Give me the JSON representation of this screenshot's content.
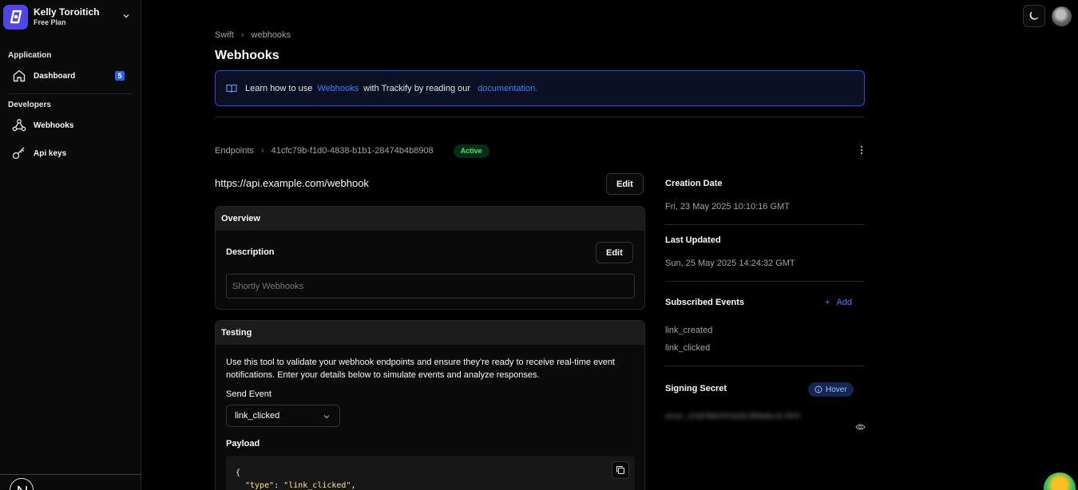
{
  "account": {
    "name": "Kelly Toroitich",
    "plan": "Free Plan"
  },
  "sidebar": {
    "application_label": "Application",
    "developers_label": "Developers",
    "items": [
      {
        "label": "Dashboard",
        "icon": "home-icon",
        "badge": "5"
      },
      {
        "label": "Webhooks",
        "icon": "webhook-icon"
      },
      {
        "label": "Api keys",
        "icon": "key-icon"
      }
    ]
  },
  "breadcrumb": {
    "root": "Swift",
    "current": "webhooks"
  },
  "page": {
    "title": "Webhooks"
  },
  "banner": {
    "prefix": "Learn how to use",
    "link1": "Webhooks",
    "middle": "with Trackify by reading our",
    "link2": "documentation."
  },
  "endpoint": {
    "crumb_root": "Endpoints",
    "id": "41cfc79b-f1d0-4838-b1b1-28474b4b8908",
    "status": "Active",
    "url": "https://api.example.com/webhook",
    "edit_label": "Edit"
  },
  "overview": {
    "title": "Overview",
    "description_label": "Description",
    "edit_label": "Edit",
    "description_placeholder": "Shortly Webhooks"
  },
  "testing": {
    "title": "Testing",
    "description": "Use this tool to validate your webhook endpoints and ensure they're ready to receive real-time event notifications. Enter your details below to simulate events and analyze responses.",
    "send_event_label": "Send Event",
    "selected_event": "link_clicked",
    "payload_label": "Payload",
    "payload_line1": "{",
    "payload_key": "\"type\"",
    "payload_value": "\"link_clicked\"",
    "payload_colon": ": ",
    "payload_comma": ","
  },
  "details": {
    "creation_label": "Creation Date",
    "creation_value": "Fri, 23 May 2025 10:10:16 GMT",
    "updated_label": "Last Updated",
    "updated_value": "Sun, 25 May 2025 14:24:32 GMT",
    "events_label": "Subscribed Events",
    "add_label": "Add",
    "events": [
      "link_created",
      "link_clicked"
    ],
    "secret_label": "Signing Secret",
    "hover_label": "Hover",
    "secret_value": "whsec_d7a8f9b0f9fde3bc999e8ec9c7879"
  },
  "colors": {
    "accent": "#3b82f6",
    "brand": "#4f46e5",
    "active": "#4ade80",
    "background": "#000000"
  }
}
